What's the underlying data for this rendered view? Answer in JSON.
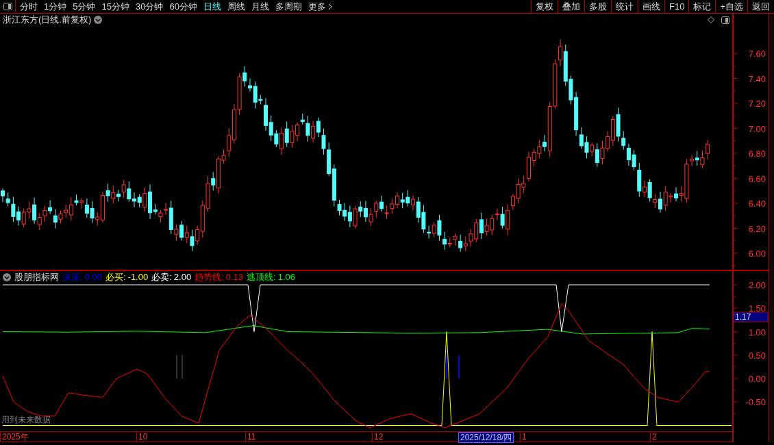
{
  "toolbar": {
    "period_tabs": [
      {
        "label": "分时",
        "selected": false
      },
      {
        "label": "1分钟",
        "selected": false
      },
      {
        "label": "5分钟",
        "selected": false
      },
      {
        "label": "15分钟",
        "selected": false
      },
      {
        "label": "30分钟",
        "selected": false
      },
      {
        "label": "60分钟",
        "selected": false
      },
      {
        "label": "日线",
        "selected": true
      },
      {
        "label": "周线",
        "selected": false
      },
      {
        "label": "月线",
        "selected": false
      },
      {
        "label": "多周期",
        "selected": false
      },
      {
        "label": "更多",
        "selected": false
      }
    ],
    "buttons": [
      "复权",
      "叠加",
      "多股",
      "统计",
      "画线",
      "F10",
      "标记",
      "+自选",
      "返回"
    ]
  },
  "main_chart": {
    "title": "浙江东方(日线.前复权)"
  },
  "price_axis": {
    "ticks": [
      "7.60",
      "7.40",
      "7.20",
      "7.00",
      "6.80",
      "6.60",
      "6.40",
      "6.20",
      "6.00"
    ]
  },
  "indicator": {
    "name": "股朋指标网",
    "legend": [
      {
        "label": "决策:",
        "value": "0.00",
        "color": "#0000ff"
      },
      {
        "label": "必买:",
        "value": "-1.00",
        "color": "#ffff00"
      },
      {
        "label": "必卖:",
        "value": "2.00",
        "color": "#ffffff"
      },
      {
        "label": "趋势线:",
        "value": "0.13",
        "color": "#ff0000"
      },
      {
        "label": "逃顶线:",
        "value": "1.06",
        "color": "#00ff00"
      }
    ],
    "notice": "用到未来数据"
  },
  "indicator_axis": {
    "ticks": [
      "2.00",
      "1.50",
      "1.00",
      "0.50",
      "0.00",
      "-0.50"
    ],
    "cursor_value": "1.17"
  },
  "date_axis": {
    "labels": [
      "2025年",
      "10",
      "11",
      "12",
      "1",
      "2"
    ],
    "cursor_date": "2025/12/18/四"
  }
}
